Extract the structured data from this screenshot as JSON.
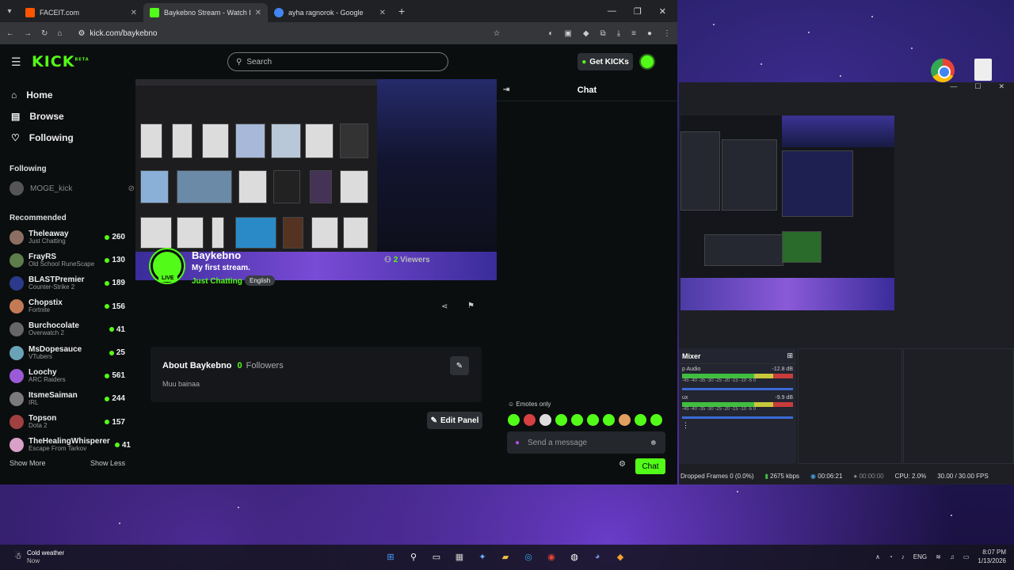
{
  "browser": {
    "tabs": [
      {
        "title": "FACEIT.com",
        "active": false
      },
      {
        "title": "Baykebno Stream - Watch Live",
        "active": true
      },
      {
        "title": "ayha ragnorok - Google",
        "active": false
      }
    ],
    "url": "kick.com/baykebno"
  },
  "kick": {
    "logo": "KICK",
    "logo_sup": "BETA",
    "search_placeholder": "Search",
    "get_kicks": "Get KICKs",
    "nav": [
      {
        "label": "Home",
        "icon": "home-icon"
      },
      {
        "label": "Browse",
        "icon": "browse-icon"
      },
      {
        "label": "Following",
        "icon": "heart-icon"
      }
    ],
    "following_heading": "Following",
    "following": [
      {
        "name": "MOGE_kick"
      }
    ],
    "recommended_heading": "Recommended",
    "recommended": [
      {
        "name": "Theleaway",
        "category": "Just Chatting",
        "viewers": "260",
        "color": "#8d6e63"
      },
      {
        "name": "FrayRS",
        "category": "Old School RuneScape",
        "viewers": "130",
        "color": "#5d7d4a"
      },
      {
        "name": "BLASTPremier",
        "category": "Counter-Strike 2",
        "viewers": "189",
        "color": "#2b3a8a"
      },
      {
        "name": "Chopstix",
        "category": "Fortnite",
        "viewers": "156",
        "color": "#c47a54"
      },
      {
        "name": "Burchocolate",
        "category": "Overwatch 2",
        "viewers": "41",
        "color": "#666666"
      },
      {
        "name": "MsDopesauce",
        "category": "VTubers",
        "viewers": "25",
        "color": "#6aa3b8"
      },
      {
        "name": "Loochy",
        "category": "ARC Raiders",
        "viewers": "561",
        "color": "#9b5bd6"
      },
      {
        "name": "ItsmeSaiman",
        "category": "IRL",
        "viewers": "244",
        "color": "#7a7a7a"
      },
      {
        "name": "Topson",
        "category": "Dota 2",
        "viewers": "157",
        "color": "#a04040"
      },
      {
        "name": "TheHealingWhisperer",
        "category": "Escape From Tarkov",
        "viewers": "41",
        "color": "#d9a0c8"
      }
    ],
    "show_more": "Show More",
    "show_less": "Show Less",
    "streamer": {
      "name": "Baykebno",
      "title": "My first stream.",
      "category": "Just Chatting",
      "language": "English",
      "live_badge": "LIVE",
      "viewer_count": "2",
      "viewer_label": "Viewers"
    },
    "about": {
      "title": "About Baykebno",
      "followers_count": "0",
      "followers_label": "Followers",
      "description": "Muu bainaa"
    },
    "edit_panel": "Edit Panel",
    "chat": {
      "title": "Chat",
      "emotes_only": "Emotes only",
      "placeholder": "Send a message",
      "send": "Chat"
    }
  },
  "obs": {
    "mixer_title": "Mixer",
    "tracks": [
      {
        "name": "p Audio",
        "db": "-12.8 dB"
      },
      {
        "name": "ux",
        "db": "-9.9 dB"
      }
    ],
    "scale": "-45 -40 -35 -30 -25 -20 -15 -10 -5 0",
    "dropped": "Dropped Frames 0 (0.0%)",
    "kbps": "2675 kbps",
    "live_time": "00:06:21",
    "rec_time": "00:00:00",
    "cpu": "CPU: 2.0%",
    "fps": "30.00 / 30.00 FPS"
  },
  "taskbar": {
    "weather_title": "Cold weather",
    "weather_sub": "Now",
    "lang": "ENG",
    "time": "8:07 PM",
    "date": "1/13/2026"
  },
  "colors": {
    "kick_green": "#53fc18",
    "page_bg": "#0b0e0f"
  }
}
